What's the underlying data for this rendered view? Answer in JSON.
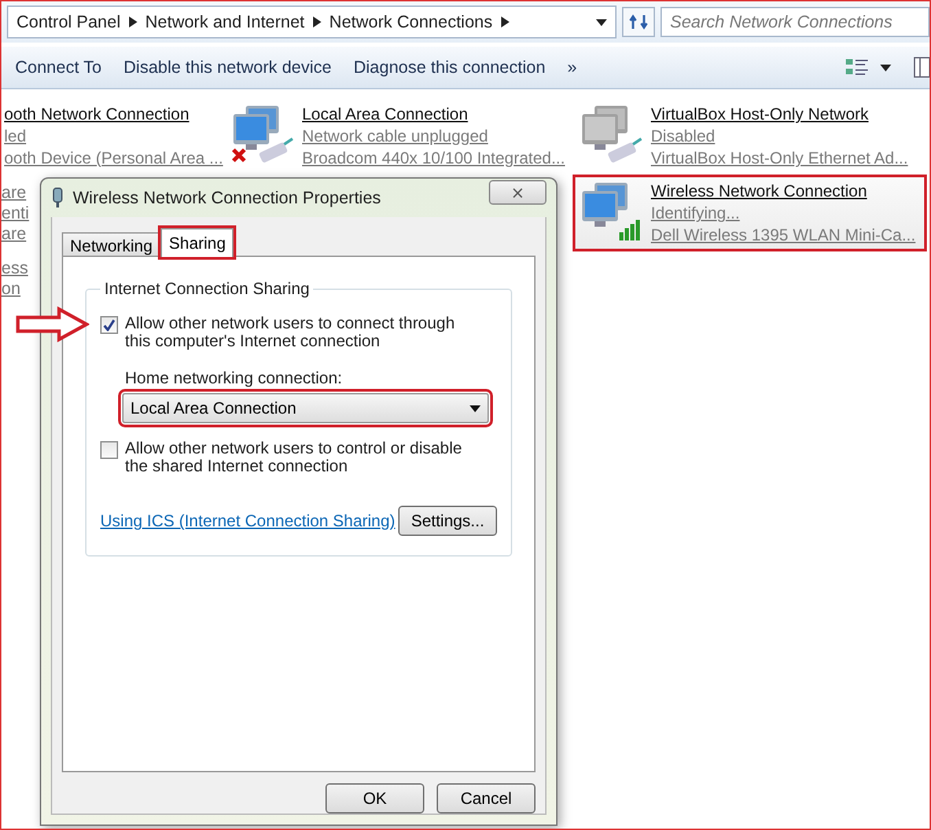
{
  "address_bar": {
    "crumbs": [
      "Control Panel",
      "Network and Internet",
      "Network Connections"
    ]
  },
  "search": {
    "placeholder": "Search Network Connections"
  },
  "toolbar": {
    "items": [
      "Connect To",
      "Disable this network device",
      "Diagnose this connection",
      "»"
    ]
  },
  "connections": [
    {
      "kind": "cut",
      "name": "ooth Network Connection",
      "status": "led",
      "device": "ooth Device (Personal Area ...",
      "selected": false,
      "highlighted": false
    },
    {
      "kind": "unplugged",
      "name": "Local Area Connection",
      "status": "Network cable unplugged",
      "device": "Broadcom 440x 10/100 Integrated...",
      "selected": false,
      "highlighted": false
    },
    {
      "kind": "disabled",
      "name": "VirtualBox Host-Only Network",
      "status": "Disabled",
      "device": "VirtualBox Host-Only Ethernet Ad...",
      "selected": false,
      "highlighted": false
    },
    {
      "kind": "wireless",
      "name": "Wireless Network Connection",
      "status": "Identifying...",
      "device": "Dell Wireless 1395 WLAN Mini-Ca...",
      "selected": true,
      "highlighted": true
    }
  ],
  "behind_fragments": [
    "are",
    "enti",
    "are",
    "ess",
    "on"
  ],
  "dialog": {
    "title": "Wireless Network Connection Properties",
    "close": "⨯",
    "tabs": [
      {
        "label": "Networking",
        "selected": false,
        "highlighted": false
      },
      {
        "label": "Sharing",
        "selected": true,
        "highlighted": true
      }
    ],
    "group_title": "Internet Connection Sharing",
    "options": [
      {
        "label": "Allow other network users to connect through this computer's Internet connection",
        "checked": true,
        "pointed": true
      },
      {
        "label": "Allow other network users to control or disable the shared Internet connection",
        "checked": false,
        "pointed": false
      }
    ],
    "home_label": "Home networking connection:",
    "home_select": {
      "value": "Local Area Connection",
      "highlighted": true
    },
    "link": "Using ICS (Internet Connection Sharing)",
    "settings": "Settings...",
    "buttons": [
      "OK",
      "Cancel"
    ]
  }
}
